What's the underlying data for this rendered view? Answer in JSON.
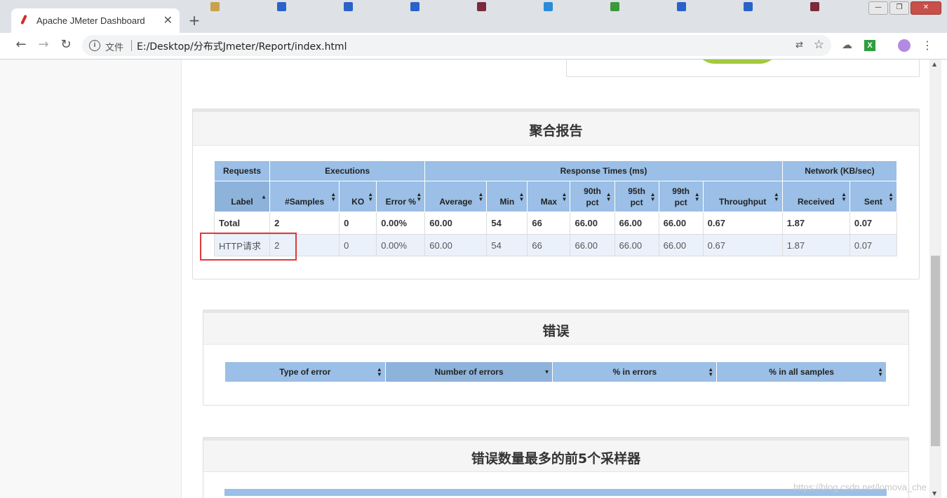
{
  "browser": {
    "active_tab_title": "Apache JMeter Dashboard",
    "address_security": "文件",
    "url": "E:/Desktop/分布式Jmeter/Report/index.html",
    "background_tabs": [
      {
        "fav": "#c9a24a"
      },
      {
        "fav": "#2a62c9"
      },
      {
        "fav": "#2a62c9"
      },
      {
        "fav": "#2a62c9"
      },
      {
        "fav": "#7a2a3a"
      },
      {
        "fav": "#2a8cd8"
      },
      {
        "fav": "#3a9a3a"
      },
      {
        "fav": "#2a62c9"
      },
      {
        "fav": "#2a62c9"
      },
      {
        "fav": "#7a2a3a"
      }
    ]
  },
  "aggregate": {
    "title": "聚合报告",
    "group_headers": [
      "Requests",
      "Executions",
      "Response Times (ms)",
      "Network (KB/sec)"
    ],
    "columns": [
      "Label",
      "#Samples",
      "KO",
      "Error %",
      "Average",
      "Min",
      "Max",
      "90th pct",
      "95th pct",
      "99th pct",
      "Throughput",
      "Received",
      "Sent"
    ],
    "columns_split": [
      [
        "Label"
      ],
      [
        "#Samples"
      ],
      [
        "KO"
      ],
      [
        "Error %"
      ],
      [
        "Average"
      ],
      [
        "Min"
      ],
      [
        "Max"
      ],
      [
        "90th",
        "pct"
      ],
      [
        "95th",
        "pct"
      ],
      [
        "99th",
        "pct"
      ],
      [
        "Throughput"
      ],
      [
        "Received"
      ],
      [
        "Sent"
      ]
    ],
    "rows": [
      [
        "Total",
        "2",
        "0",
        "0.00%",
        "60.00",
        "54",
        "66",
        "66.00",
        "66.00",
        "66.00",
        "0.67",
        "1.87",
        "0.07"
      ],
      [
        "HTTP请求",
        "2",
        "0",
        "0.00%",
        "60.00",
        "54",
        "66",
        "66.00",
        "66.00",
        "66.00",
        "0.67",
        "1.87",
        "0.07"
      ]
    ]
  },
  "errors": {
    "title": "错误",
    "columns": [
      "Type of error",
      "Number of errors",
      "% in errors",
      "% in all samples"
    ]
  },
  "top5": {
    "title": "错误数量最多的前5个采样器"
  },
  "watermark": "https://blog.csdn.net/lomova_che"
}
